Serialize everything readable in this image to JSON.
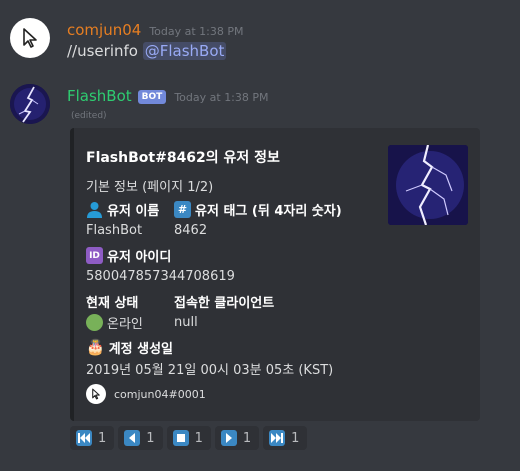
{
  "messages": [
    {
      "author": "comjun04",
      "timestamp": "Today at 1:38 PM",
      "text_prefix": "//userinfo ",
      "mention": "@FlashBot"
    },
    {
      "author": "FlashBot",
      "bot_tag": "BOT",
      "timestamp": "Today at 1:38 PM",
      "edited": "(edited)"
    }
  ],
  "embed": {
    "title": "FlashBot#8462의 유저 정보",
    "description": "기본 정보 (페이지 1/2)",
    "fields": {
      "username_label": "유저 이름",
      "username_value": "FlashBot",
      "tag_label": "유저 태그 (뒤 4자리 숫자)",
      "tag_value": "8462",
      "id_label": "유저 아이디",
      "id_value": "580047857344708619",
      "status_label": "현재 상태",
      "status_value": "온라인",
      "client_label": "접속한 클라이언트",
      "client_value": "null",
      "created_label": "계정 생성일",
      "created_value": "2019년 05월 21일 00시 03분 05초 (KST)"
    },
    "emoji": {
      "hash": "#",
      "id": "ID",
      "cake": "🎂"
    },
    "footer": "comjun04#0001"
  },
  "reactions": [
    {
      "icon": "first-page-icon",
      "count": "1"
    },
    {
      "icon": "previous-page-icon",
      "count": "1"
    },
    {
      "icon": "stop-icon",
      "count": "1"
    },
    {
      "icon": "next-page-icon",
      "count": "1"
    },
    {
      "icon": "last-page-icon",
      "count": "1"
    }
  ],
  "colors": {
    "background": "#36393f",
    "embed_background": "#2f3136",
    "user_name": "#e67e22",
    "bot_name": "#2ecc71",
    "bot_tag": "#7289da",
    "reaction_icon": "#3b88c3"
  }
}
